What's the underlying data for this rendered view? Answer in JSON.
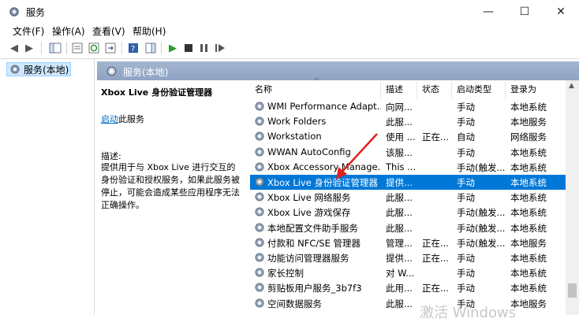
{
  "window": {
    "title": "服务",
    "minimize": "—",
    "maximize": "☐",
    "close": "✕"
  },
  "menu": [
    "文件(F)",
    "操作(A)",
    "查看(V)",
    "帮助(H)"
  ],
  "tree": {
    "item": "服务(本地)"
  },
  "pane": {
    "title": "服务(本地)"
  },
  "desc": {
    "service_name": "Xbox Live 身份验证管理器",
    "start_link": "启动",
    "start_suffix": "此服务",
    "label": "描述:",
    "text": "提供用于与 Xbox Live 进行交互的身份验证和授权服务，如果此服务被停止，可能会造成某些应用程序无法正确操作。"
  },
  "columns": [
    "名称",
    "描述",
    "状态",
    "启动类型",
    "登录为"
  ],
  "rows": [
    {
      "name": "WMI Performance Adapt...",
      "desc": "向网...",
      "status": "",
      "start": "手动",
      "logon": "本地系统"
    },
    {
      "name": "Work Folders",
      "desc": "此服...",
      "status": "",
      "start": "手动",
      "logon": "本地服务"
    },
    {
      "name": "Workstation",
      "desc": "使用 ...",
      "status": "正在...",
      "start": "自动",
      "logon": "网络服务"
    },
    {
      "name": "WWAN AutoConfig",
      "desc": "该服...",
      "status": "",
      "start": "手动",
      "logon": "本地系统"
    },
    {
      "name": "Xbox Accessory Manage...",
      "desc": "This ...",
      "status": "",
      "start": "手动(触发...",
      "logon": "本地系统"
    },
    {
      "name": "Xbox Live 身份验证管理器",
      "desc": "提供...",
      "status": "",
      "start": "手动",
      "logon": "本地系统"
    },
    {
      "name": "Xbox Live 网络服务",
      "desc": "此服...",
      "status": "",
      "start": "手动",
      "logon": "本地系统"
    },
    {
      "name": "Xbox Live 游戏保存",
      "desc": "此服...",
      "status": "",
      "start": "手动(触发...",
      "logon": "本地系统"
    },
    {
      "name": "本地配置文件助手服务",
      "desc": "此服...",
      "status": "",
      "start": "手动(触发...",
      "logon": "本地系统"
    },
    {
      "name": "付款和 NFC/SE 管理器",
      "desc": "管理...",
      "status": "正在...",
      "start": "手动(触发...",
      "logon": "本地服务"
    },
    {
      "name": "功能访问管理器服务",
      "desc": "提供...",
      "status": "正在...",
      "start": "手动",
      "logon": "本地系统"
    },
    {
      "name": "家长控制",
      "desc": "对 W...",
      "status": "",
      "start": "手动",
      "logon": "本地系统"
    },
    {
      "name": "剪贴板用户服务_3b7f3",
      "desc": "此用...",
      "status": "正在...",
      "start": "手动",
      "logon": "本地系统"
    },
    {
      "name": "空间数据服务",
      "desc": "此服...",
      "status": "",
      "start": "手动",
      "logon": "本地服务"
    }
  ],
  "selected_row": 5,
  "watermark": "激活 Windows",
  "colors": {
    "selection": "#0078d7",
    "header": "#8fa3c3",
    "arrow": "#e02020"
  }
}
